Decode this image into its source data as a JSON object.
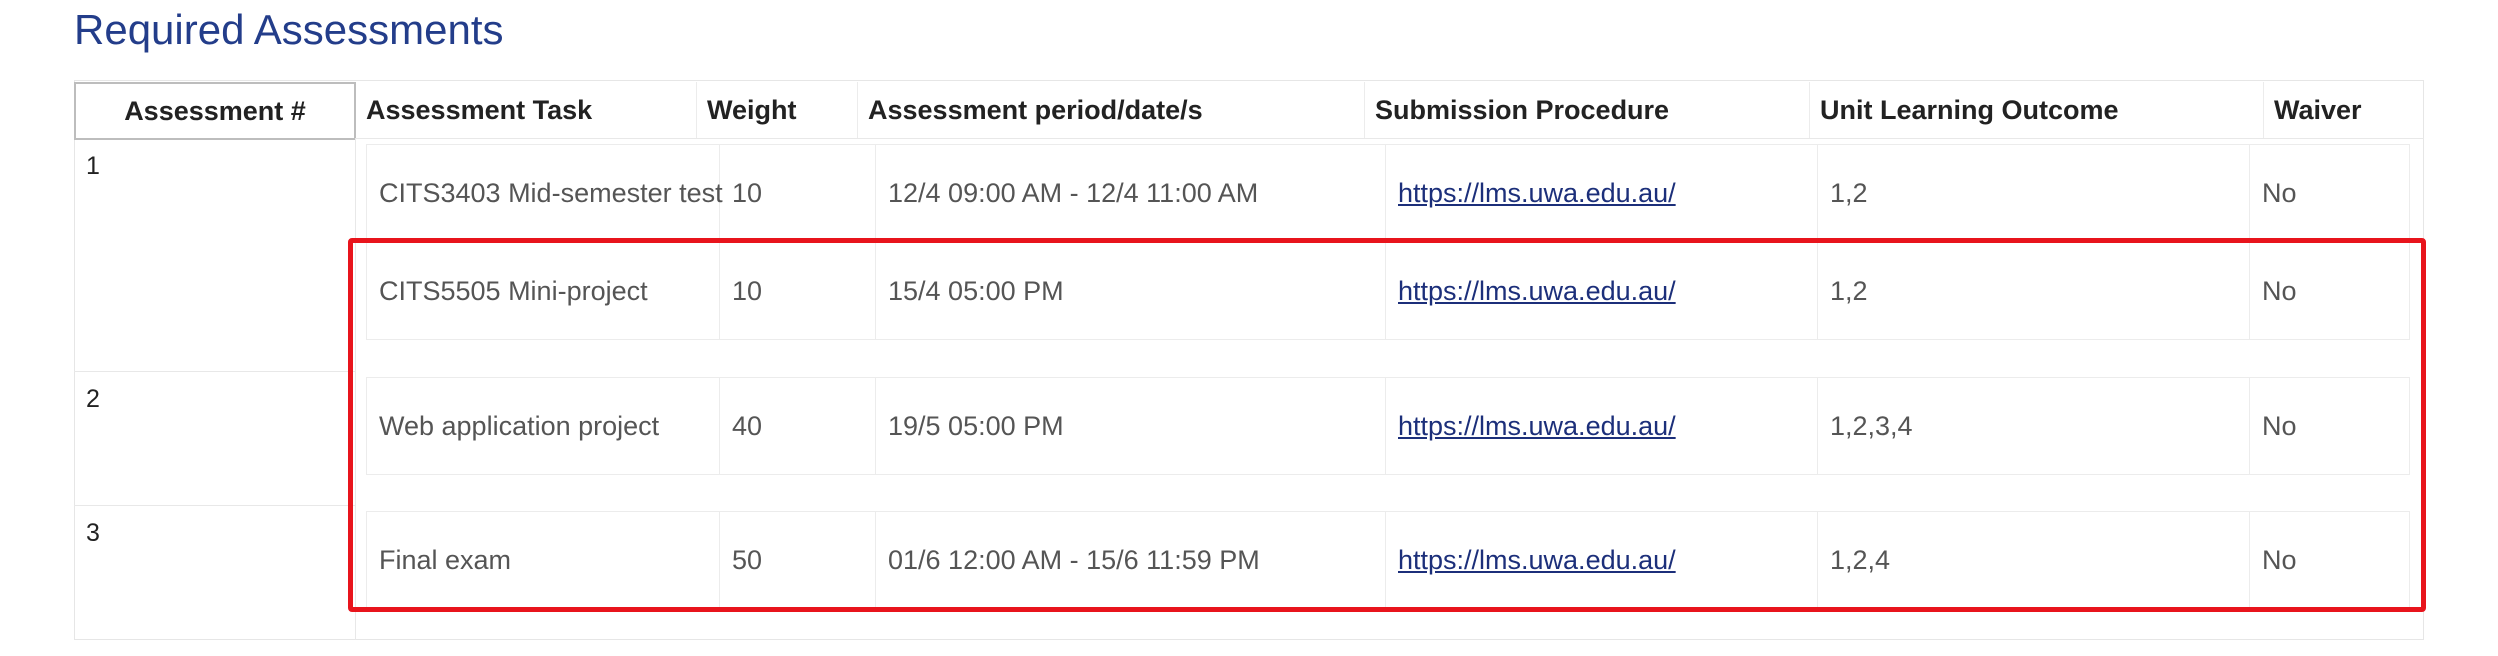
{
  "page": {
    "title": "Required Assessments"
  },
  "table": {
    "headers": {
      "num": "Assessment #",
      "task": "Assessment Task",
      "weight": "Weight",
      "period": "Assessment period/date/s",
      "submission": "Submission Procedure",
      "outcome": "Unit Learning Outcome",
      "waiver": "Waiver"
    },
    "groups": [
      {
        "num": "1",
        "rows": [
          {
            "task": "CITS3403 Mid-semester test",
            "weight": "10",
            "period": "12/4 09:00 AM - 12/4 11:00 AM",
            "submission": "https://lms.uwa.edu.au/",
            "outcome": "1,2",
            "waiver": "No"
          },
          {
            "task": "CITS5505 Mini-project",
            "weight": "10",
            "period": "15/4 05:00 PM",
            "submission": "https://lms.uwa.edu.au/",
            "outcome": "1,2",
            "waiver": "No"
          }
        ]
      },
      {
        "num": "2",
        "rows": [
          {
            "task": "Web application project",
            "weight": "40",
            "period": "19/5 05:00 PM",
            "submission": "https://lms.uwa.edu.au/",
            "outcome": "1,2,3,4",
            "waiver": "No"
          }
        ]
      },
      {
        "num": "3",
        "rows": [
          {
            "task": "Final exam",
            "weight": "50",
            "period": "01/6 12:00 AM - 15/6 11:59 PM",
            "submission": "https://lms.uwa.edu.au/",
            "outcome": "1,2,4",
            "waiver": "No"
          }
        ]
      }
    ]
  },
  "colors": {
    "title": "#233d8a",
    "link": "#1c2f7a",
    "highlight_border": "#e8141c"
  }
}
